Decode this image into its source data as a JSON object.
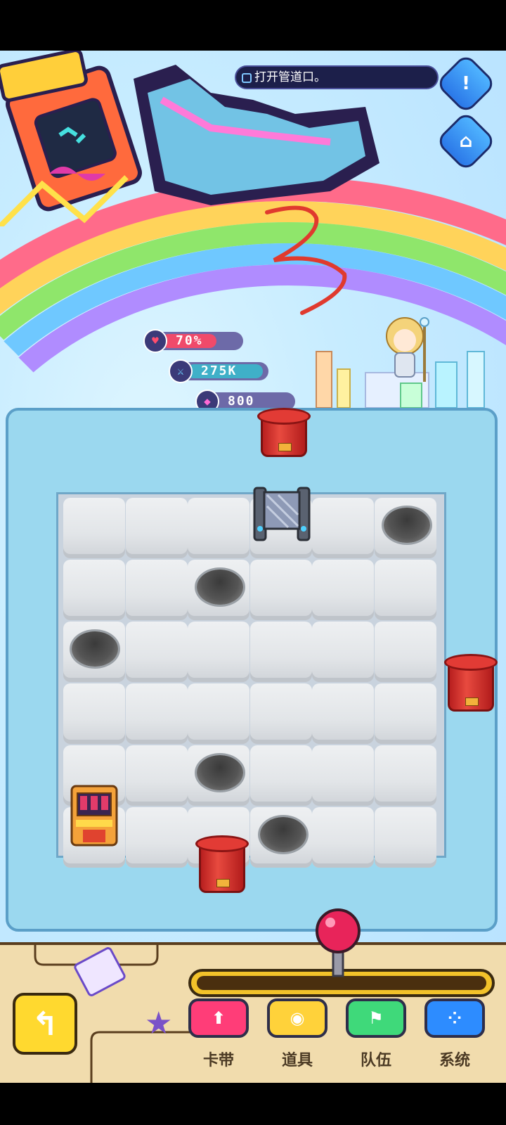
{
  "quest": {
    "text": "打开管道口。"
  },
  "side_buttons": {
    "alert": "!",
    "map": "⌂"
  },
  "stats": {
    "hp": {
      "value": "70%",
      "level": 0.7,
      "color": "#f04a6a"
    },
    "attack": {
      "value": "275K",
      "color": "#3fb0c8"
    },
    "gems": {
      "value": "800",
      "color": "#8c7cd8"
    }
  },
  "hud": {
    "back_icon": "↰",
    "buttons": [
      {
        "label": "卡带",
        "icon": "⬆",
        "color": "#ff3d78"
      },
      {
        "label": "道具",
        "icon": "◉",
        "color": "#ffd23a"
      },
      {
        "label": "队伍",
        "icon": "⚑",
        "color": "#3fd97a"
      },
      {
        "label": "系统",
        "icon": "⁘",
        "color": "#2d8cff"
      }
    ]
  },
  "colors": {
    "wall": "#9bd8ef",
    "floor": "#e2e5e8",
    "pipe": "#e23b35",
    "hud": "#f1dcad"
  }
}
